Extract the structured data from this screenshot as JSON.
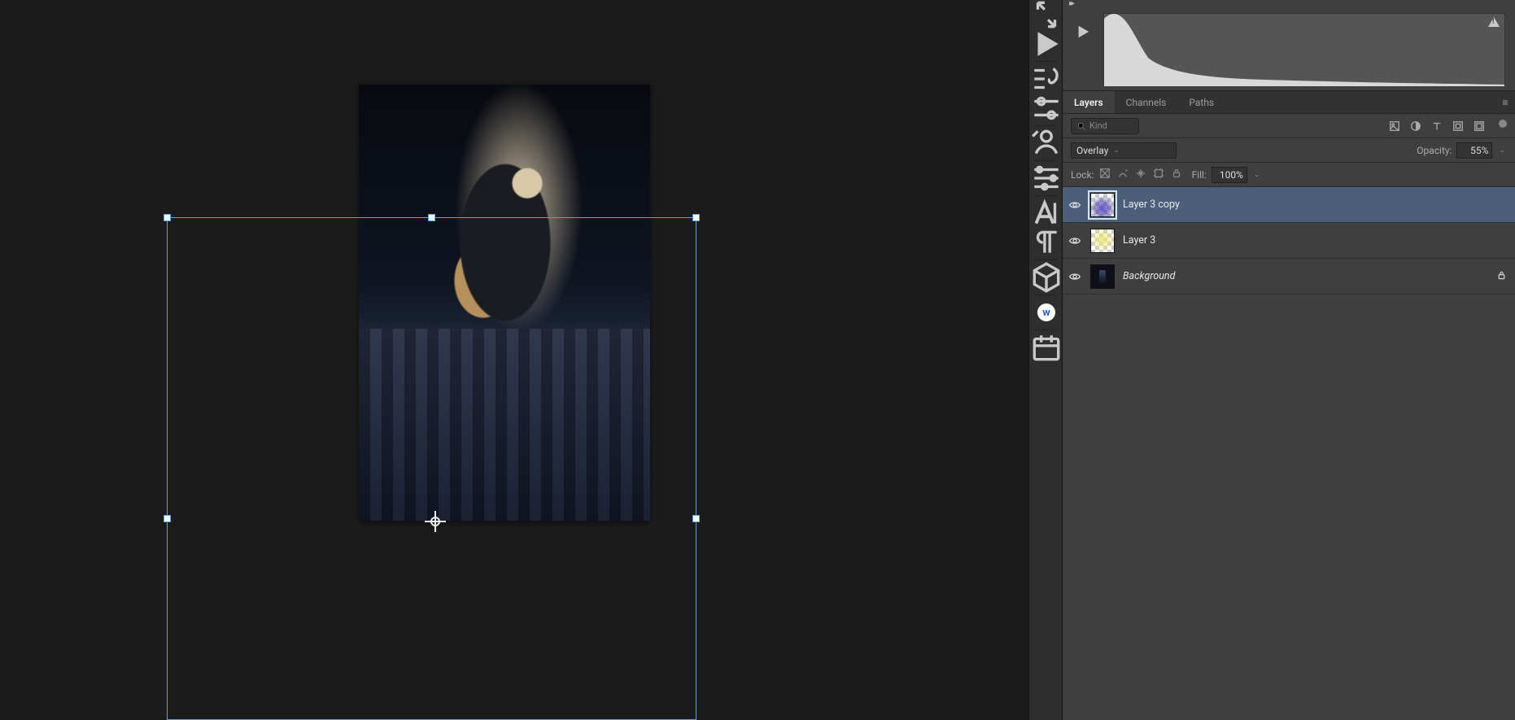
{
  "panels": {
    "tabs": {
      "layers": "Layers",
      "channels": "Channels",
      "paths": "Paths"
    },
    "filter": {
      "kind": "Kind"
    },
    "blend": {
      "mode": "Overlay",
      "opacity_label": "Opacity:",
      "opacity": "55%"
    },
    "lock": {
      "label": "Lock:",
      "fill_label": "Fill:",
      "fill": "100%"
    }
  },
  "layers": [
    {
      "name": "Layer 3 copy",
      "selected": true,
      "visible": true,
      "thumb": "purple",
      "locked": false,
      "italic": false
    },
    {
      "name": "Layer 3",
      "selected": false,
      "visible": true,
      "thumb": "yellow",
      "locked": false,
      "italic": false
    },
    {
      "name": "Background",
      "selected": false,
      "visible": true,
      "thumb": "bg",
      "locked": true,
      "italic": true
    }
  ],
  "dock": {
    "w_badge": "w"
  }
}
